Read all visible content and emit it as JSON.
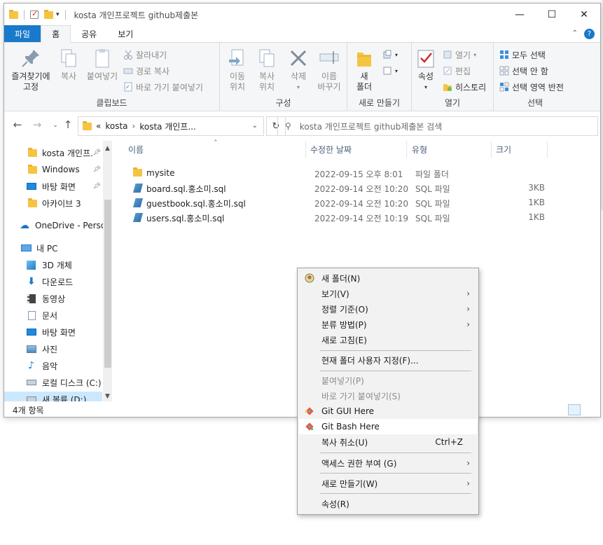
{
  "window": {
    "title": "kosta 개인프로젝트 github제출본",
    "controls": {
      "minimize": "—",
      "maximize": "☐",
      "close": "✕"
    }
  },
  "ribbon_tabs": [
    "파일",
    "홈",
    "공유",
    "보기"
  ],
  "ribbon": {
    "clipboard": {
      "label": "클립보드",
      "pin_line1": "즐겨찾기에",
      "pin_line2": "고정",
      "copy": "복사",
      "paste": "붙여넣기",
      "cut": "잘라내기",
      "copy_path": "경로 복사",
      "paste_shortcut": "바로 가기 붙여넣기"
    },
    "organize": {
      "label": "구성",
      "move_line1": "이동",
      "move_line2": "위치",
      "copyto_line1": "복사",
      "copyto_line2": "위치",
      "delete": "삭제",
      "rename_line1": "이름",
      "rename_line2": "바꾸기"
    },
    "new": {
      "label": "새로 만들기",
      "folder_line1": "새",
      "folder_line2": "폴더"
    },
    "open": {
      "label": "열기",
      "properties": "속성",
      "open": "열기",
      "edit": "편집",
      "history": "히스토리"
    },
    "select": {
      "label": "선택",
      "all": "모두 선택",
      "none": "선택 안 함",
      "invert": "선택 영역 반전"
    }
  },
  "address": {
    "overflow": "«",
    "crumb1": "kosta",
    "crumb2": "kosta 개인프...",
    "search_placeholder": "kosta 개인프로젝트 github제출본 검색"
  },
  "nav_pane": [
    {
      "label": "kosta 개인프.",
      "icon": "folder-icon",
      "pinned": true
    },
    {
      "label": "Windows",
      "icon": "folder-icon",
      "pinned": true
    },
    {
      "label": "바탕 화면",
      "icon": "desktop-icon",
      "pinned": true
    },
    {
      "label": "아카이브 3",
      "icon": "folder-icon",
      "pinned": false
    },
    {
      "label": "OneDrive - Person",
      "icon": "cloud-icon",
      "pinned": false
    },
    {
      "label": "내 PC",
      "icon": "pc-icon",
      "pinned": false
    },
    {
      "label": "3D 개체",
      "icon": "cube-icon",
      "pinned": false
    },
    {
      "label": "다운로드",
      "icon": "download-icon",
      "pinned": false
    },
    {
      "label": "동영상",
      "icon": "video-icon",
      "pinned": false
    },
    {
      "label": "문서",
      "icon": "document-icon",
      "pinned": false
    },
    {
      "label": "바탕 화면",
      "icon": "desktop-icon",
      "pinned": false
    },
    {
      "label": "사진",
      "icon": "picture-icon",
      "pinned": false
    },
    {
      "label": "음악",
      "icon": "music-icon",
      "pinned": false
    },
    {
      "label": "로컬 디스크 (C:)",
      "icon": "disk-icon",
      "pinned": false
    },
    {
      "label": "새 볼륨 (D:)",
      "icon": "disk-icon",
      "pinned": false
    }
  ],
  "columns": {
    "name": "이름",
    "modified": "수정한 날짜",
    "type": "유형",
    "size": "크기"
  },
  "files": [
    {
      "name": "mysite",
      "modified": "2022-09-15 오후 8:01",
      "type": "파일 폴더",
      "size": "",
      "icon": "folder-icon"
    },
    {
      "name": "board.sql.홍소미.sql",
      "modified": "2022-09-14 오전 10:20",
      "type": "SQL 파일",
      "size": "3KB",
      "icon": "sql-file-icon"
    },
    {
      "name": "guestbook.sql.홍소미.sql",
      "modified": "2022-09-14 오전 10:20",
      "type": "SQL 파일",
      "size": "1KB",
      "icon": "sql-file-icon"
    },
    {
      "name": "users.sql.홍소미.sql",
      "modified": "2022-09-14 오전 10:19",
      "type": "SQL 파일",
      "size": "1KB",
      "icon": "sql-file-icon"
    }
  ],
  "status": {
    "count": "4개 항목"
  },
  "context_menu": {
    "new_folder": "새 폴더(N)",
    "view": "보기(V)",
    "sort": "정렬 기준(O)",
    "group": "분류 방법(P)",
    "refresh": "새로 고침(E)",
    "customize": "현재 폴더 사용자 지정(F)...",
    "paste": "붙여넣기(P)",
    "paste_shortcut": "바로 가기 붙여넣기(S)",
    "git_gui": "Git GUI Here",
    "git_bash": "Git Bash Here",
    "undo": "복사 취소(U)",
    "undo_shortcut": "Ctrl+Z",
    "access": "액세스 권한 부여 (G)",
    "new": "새로 만들기(W)",
    "properties": "속성(R)"
  },
  "colors": {
    "accent": "#1979ca",
    "selection": "#cce8ff",
    "folder": "#f5c542"
  }
}
